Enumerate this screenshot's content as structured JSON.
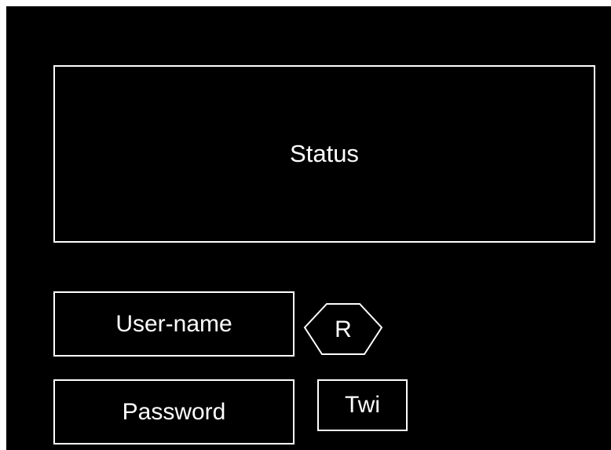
{
  "status_panel": {
    "label": "Status"
  },
  "login": {
    "username_label": "User-name",
    "password_label": "Password",
    "r_button_label": "R",
    "twi_button_label": "Twi"
  },
  "colors": {
    "background": "#000000",
    "foreground": "#ffffff",
    "page": "#ffffff"
  }
}
